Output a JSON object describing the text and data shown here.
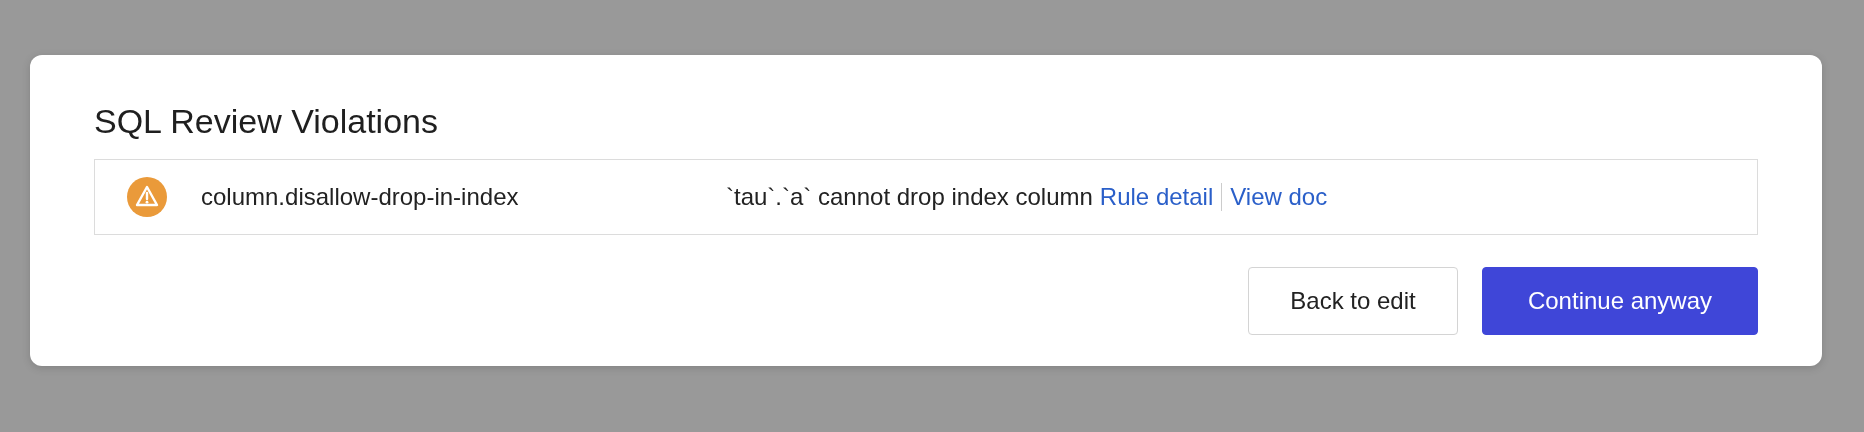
{
  "dialog": {
    "title": "SQL Review Violations",
    "violations": [
      {
        "kind": "warning",
        "rule": "column.disallow-drop-in-index",
        "message": "`tau`.`a` cannot drop index column",
        "links": [
          "Rule detail",
          "View doc"
        ]
      }
    ],
    "buttons": [
      {
        "label": "Back to edit",
        "kind": "secondary"
      },
      {
        "label": "Continue anyway",
        "kind": "primary"
      }
    ]
  }
}
